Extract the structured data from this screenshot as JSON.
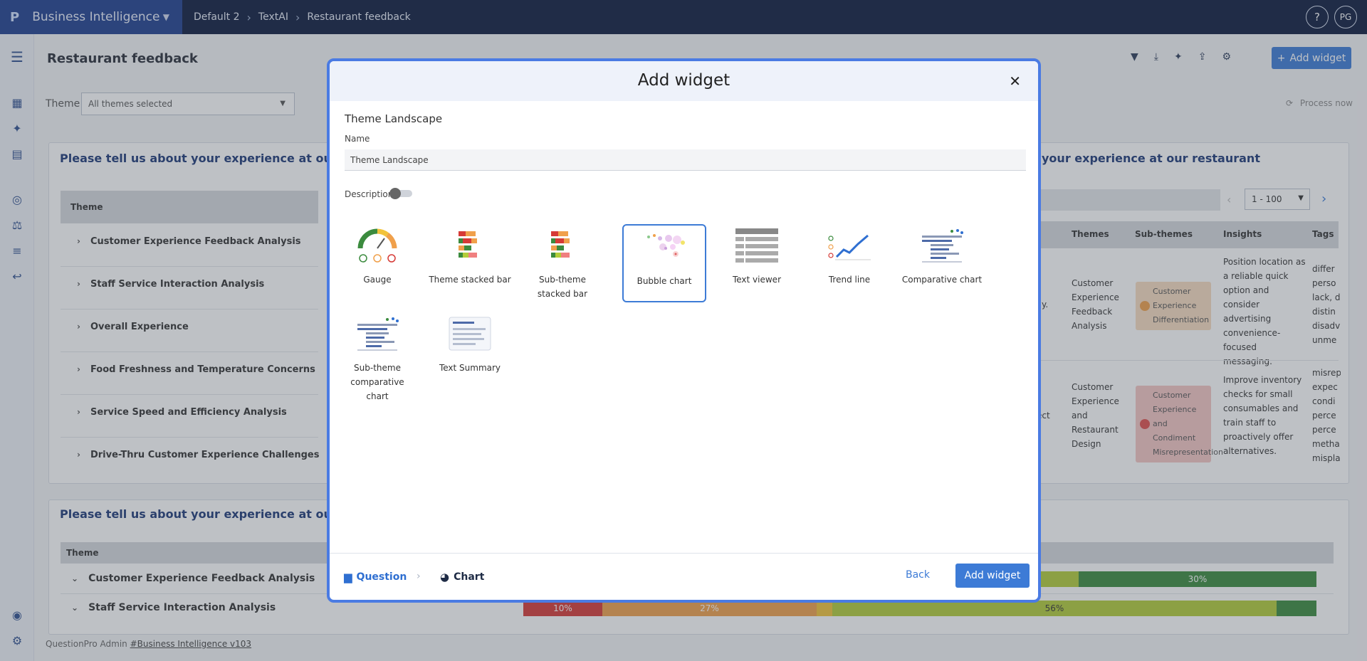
{
  "header": {
    "app_name": "Business Intelligence",
    "breadcrumbs": [
      "Default 2",
      "TextAI",
      "Restaurant feedback"
    ],
    "help": "?",
    "user_initials": "PG"
  },
  "page": {
    "title": "Restaurant feedback",
    "add_widget_label": "Add widget",
    "theme_filter_label": "Theme",
    "theme_filter_value": "All themes selected",
    "process_now": "Process now"
  },
  "widget1": {
    "title": "Please tell us about your experience at our restaura",
    "title_right": "your experience at our restaurant",
    "column_theme": "Theme",
    "rows": [
      "Customer Experience Feedback Analysis",
      "Staff Service Interaction Analysis",
      "Overall Experience",
      "Food Freshness and Temperature Concerns",
      "Service Speed and Efficiency Analysis",
      "Drive-Thru Customer Experience Challenges"
    ],
    "pager_value": "1 - 100",
    "columns_right": [
      "Themes",
      "Sub-themes",
      "Insights",
      "Tags"
    ],
    "right_rows": [
      {
        "partial": "y.",
        "theme": "Customer Experience Feedback Analysis",
        "subtheme": "Customer Experience Differentiation",
        "insight": "Position location as a reliable quick option and consider advertising convenience-focused messaging.",
        "tags": "differ perso lack, d distin disadv unme"
      },
      {
        "partial": "ect",
        "theme": "Customer Experience and Restaurant Design",
        "subtheme": "Customer Experience and Condiment Misrepresentation",
        "insight": "Improve inventory checks for small consumables and train staff to proactively offer alternatives.",
        "tags": "misrep expec condi perce perce metha mispla"
      }
    ]
  },
  "widget2": {
    "title": "Please tell us about your experience at our restaura",
    "column_theme": "Theme",
    "rows": [
      {
        "label": "Customer Experience Feedback Analysis",
        "bar": [
          "30%"
        ]
      },
      {
        "label": "Staff Service Interaction Analysis",
        "bar": [
          "10%",
          "27%",
          "56%"
        ]
      }
    ]
  },
  "footer": {
    "prefix": "QuestionPro Admin",
    "link": "#Business Intelligence v103"
  },
  "modal": {
    "title": "Add widget",
    "section_title": "Theme Landscape",
    "name_label": "Name",
    "name_value": "Theme Landscape",
    "description_label": "Description",
    "description_enabled": false,
    "widget_types": [
      {
        "id": "gauge",
        "label": "Gauge"
      },
      {
        "id": "theme-stacked-bar",
        "label": "Theme stacked bar"
      },
      {
        "id": "sub-theme-stacked-bar",
        "label": "Sub-theme stacked bar"
      },
      {
        "id": "bubble-chart",
        "label": "Bubble chart",
        "selected": true
      },
      {
        "id": "text-viewer",
        "label": "Text viewer"
      },
      {
        "id": "trend-line",
        "label": "Trend line"
      },
      {
        "id": "comparative-chart",
        "label": "Comparative chart"
      },
      {
        "id": "sub-theme-comparative-chart",
        "label": "Sub-theme comparative chart"
      },
      {
        "id": "text-summary",
        "label": "Text Summary"
      }
    ],
    "steps": [
      "Question",
      "Chart"
    ],
    "back_label": "Back",
    "submit_label": "Add widget"
  },
  "colors": {
    "accent": "#3d7bd6",
    "topbar": "#0d1b3e",
    "brand": "#1f3f8f",
    "modal_border": "#4a7be3",
    "chip_orange": "#f7dcc0",
    "chip_red": "#f5c6c4",
    "bar_red": "#d63a36",
    "bar_orange": "#f0a04b",
    "bar_lightgreen": "#b3cd3a",
    "bar_darkgreen": "#3b8b3e"
  }
}
